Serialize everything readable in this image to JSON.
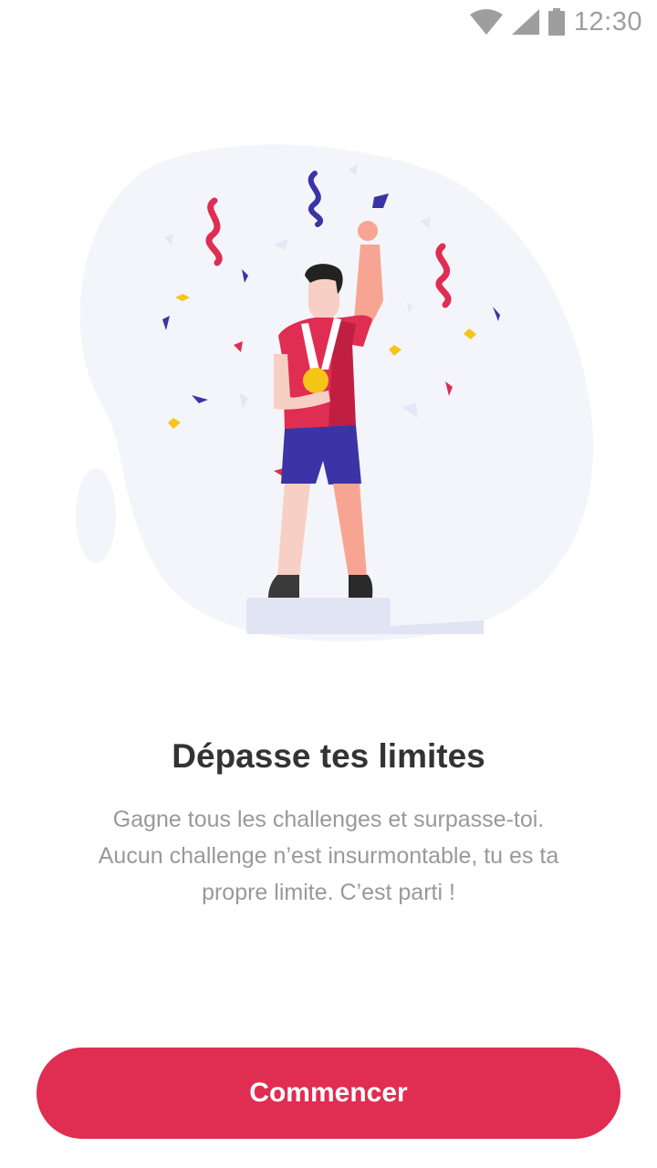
{
  "status_bar": {
    "time": "12:30",
    "icons": [
      "wifi-icon",
      "cell-signal-icon",
      "battery-icon"
    ]
  },
  "onboarding": {
    "illustration": "athlete-with-medal-confetti",
    "title": "Dépasse tes limites",
    "description_lines": [
      "Gagne tous les challenges et surpasse-toi.",
      "Aucun challenge n’est insurmontable, tu es ta",
      "propre limite. C’est parti !"
    ],
    "cta_label": "Commencer"
  },
  "colors": {
    "accent": "#e02d52",
    "title": "#333333",
    "body_text": "#999999",
    "status_icons": "#9e9e9e",
    "blob": "#f4f5fa",
    "confetti_red": "#e02d52",
    "confetti_blue": "#3a34a6",
    "confetti_yellow": "#f5c518"
  }
}
